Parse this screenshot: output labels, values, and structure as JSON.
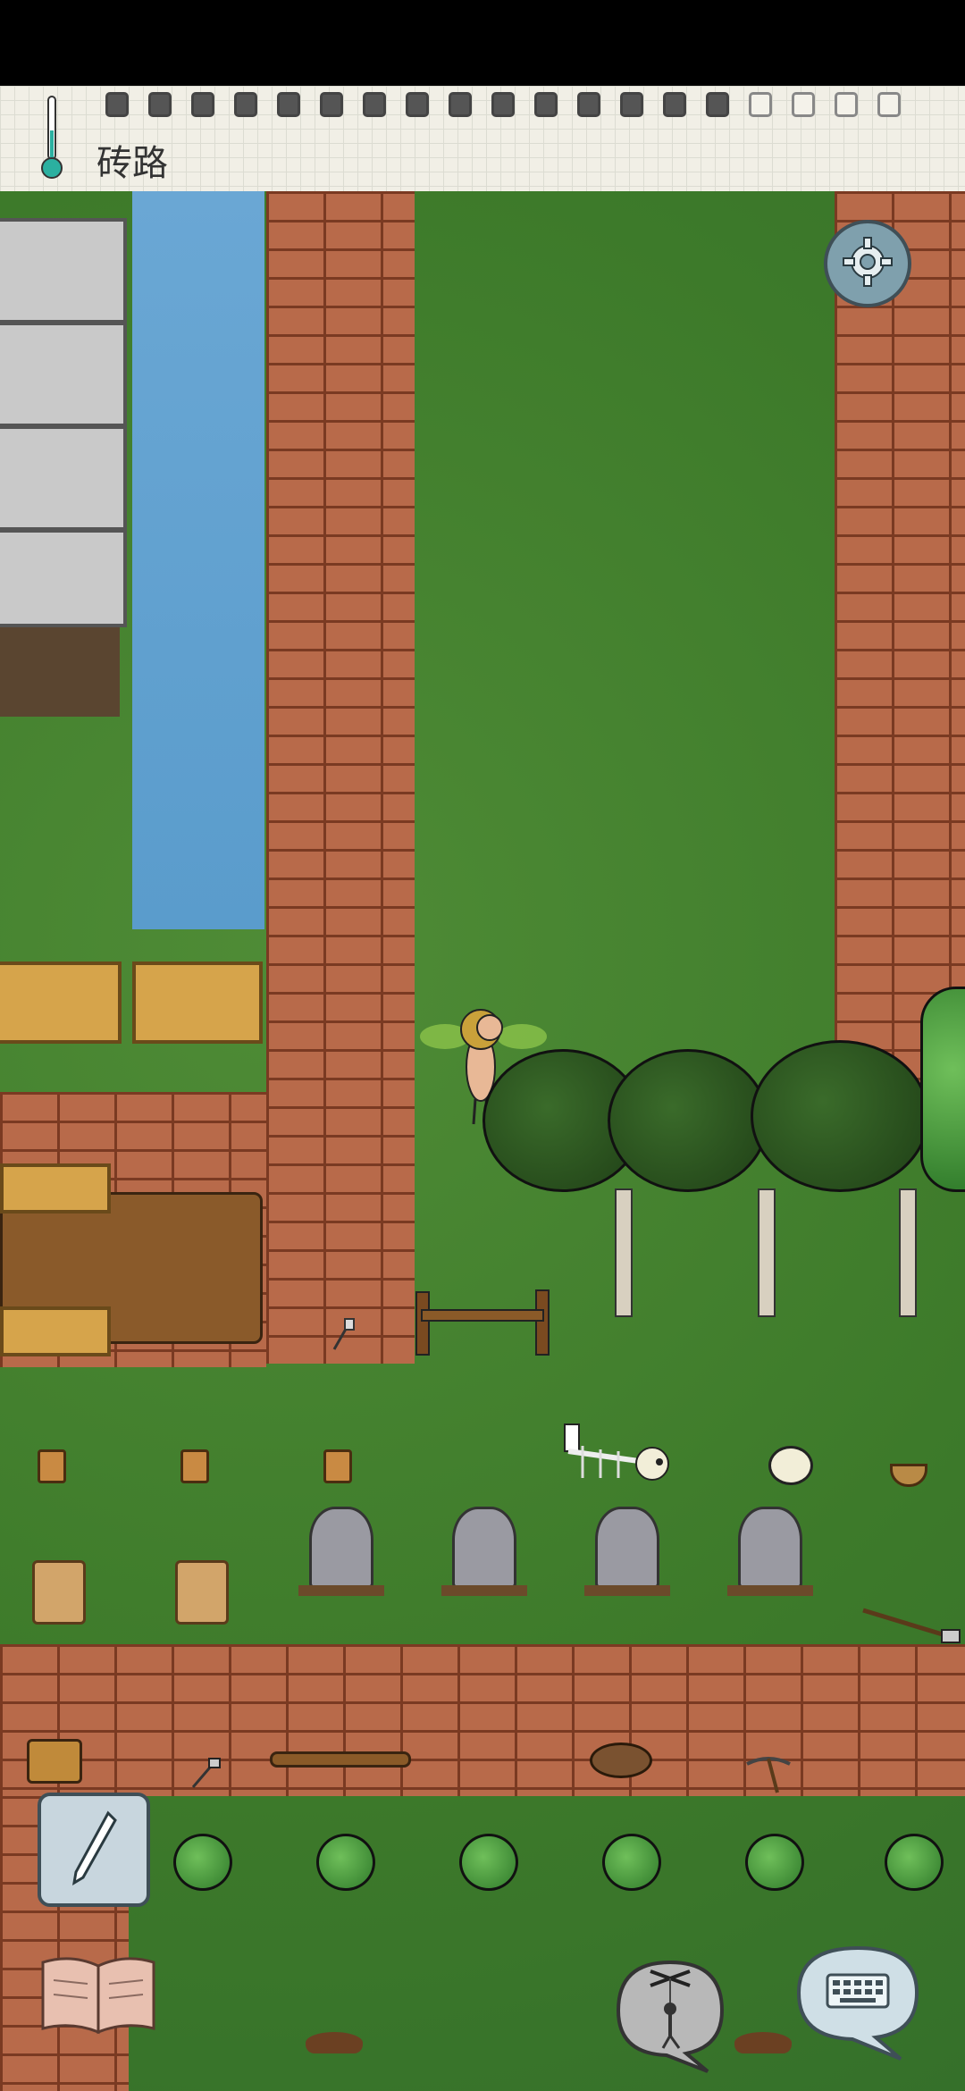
{
  "hud": {
    "location": "砖路",
    "food_pips_filled": 15,
    "food_pips_total": 19,
    "temperature_icon": "thermometer-icon"
  },
  "controls": {
    "settings_icon": "gear-icon",
    "note_icon": "pencil-icon",
    "book_icon": "open-book-icon",
    "emote_icon": "puppet-icon",
    "keyboard_icon": "keyboard-icon"
  },
  "colors": {
    "brick": "#b86a4a",
    "grass": "#3e7a2c",
    "water": "#6aa7d4"
  }
}
